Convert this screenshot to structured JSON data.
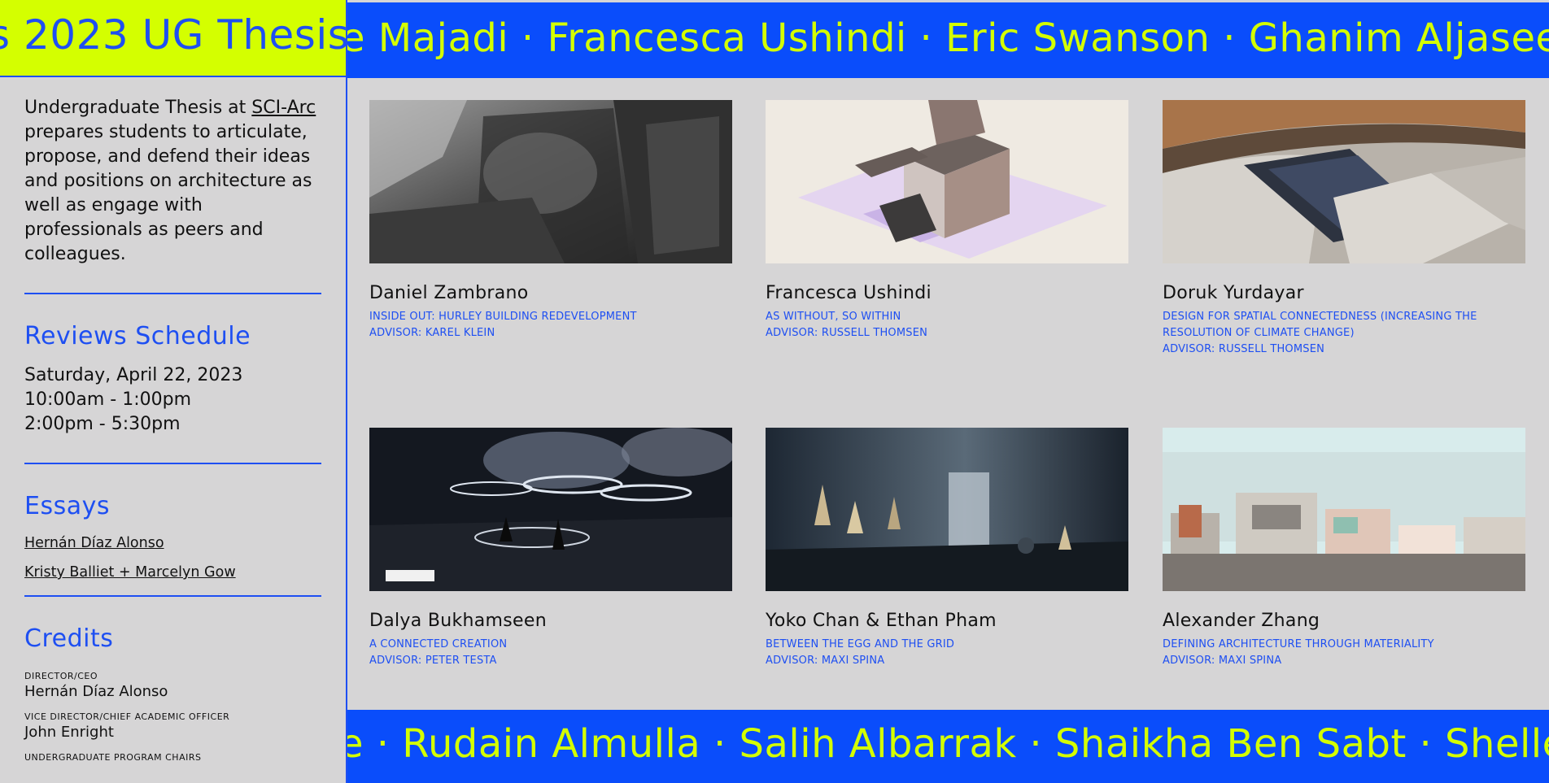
{
  "sidebar": {
    "title_band": "s 2023 UG Thesis",
    "intro_pre": "Undergraduate Thesis at ",
    "intro_link": "SCI-Arc",
    "intro_post": " prepares students to articulate, propose, and defend their ideas and positions on architecture as well as engage with professionals as peers and colleagues.",
    "reviews_heading": "Reviews Schedule",
    "schedule": [
      "Saturday, April 22, 2023",
      "10:00am - 1:00pm",
      "2:00pm - 5:30pm"
    ],
    "essays_heading": "Essays",
    "essays": [
      "Hernán Díaz Alonso",
      "Kristy Balliet + Marcelyn Gow"
    ],
    "credits_heading": "Credits",
    "credits": [
      {
        "role": "DIRECTOR/CEO",
        "name": "Hernán Díaz Alonso"
      },
      {
        "role": "VICE DIRECTOR/CHIEF ACADEMIC OFFICER",
        "name": "John Enright"
      },
      {
        "role": "UNDERGRADUATE PROGRAM CHAIRS",
        "name": ""
      }
    ]
  },
  "ticker_top": "e Majadi · Francesca Ushindi · Eric Swanson · Ghanim Aljaseem",
  "ticker_bottom": "e · Rudain Almulla · Salih Albarrak · Shaikha Ben Sabt · Shelley",
  "projects": [
    {
      "name": "Daniel Zambrano",
      "title": "INSIDE OUT: HURLEY BUILDING REDEVELOPMENT",
      "advisor": "ADVISOR: KAREL KLEIN",
      "image": "gray-interior-render"
    },
    {
      "name": "Francesca Ushindi",
      "title": "AS WITHOUT, SO WITHIN",
      "advisor": "ADVISOR: RUSSELL THOMSEN",
      "image": "axonometric-house-drawing"
    },
    {
      "name": "Doruk Yurdayar",
      "title": "DESIGN FOR SPATIAL CONNECTEDNESS (INCREASING THE RESOLUTION OF CLIMATE CHANGE)",
      "advisor": "ADVISOR: RUSSELL THOMSEN",
      "image": "aerial-roof-render"
    },
    {
      "name": "Dalya Bukhamseen",
      "title": "A CONNECTED CREATION",
      "advisor": "ADVISOR: PETER TESTA",
      "image": "night-plaza-render"
    },
    {
      "name": "Yoko Chan & Ethan Pham",
      "title": "BETWEEN THE EGG AND THE GRID",
      "advisor": "ADVISOR: MAXI SPINA",
      "image": "dark-corridor-render"
    },
    {
      "name": "Alexander Zhang",
      "title": "DEFINING ARCHITECTURE THROUGH MATERIALITY",
      "advisor": "ADVISOR: MAXI SPINA",
      "image": "city-elevation-collage"
    }
  ]
}
